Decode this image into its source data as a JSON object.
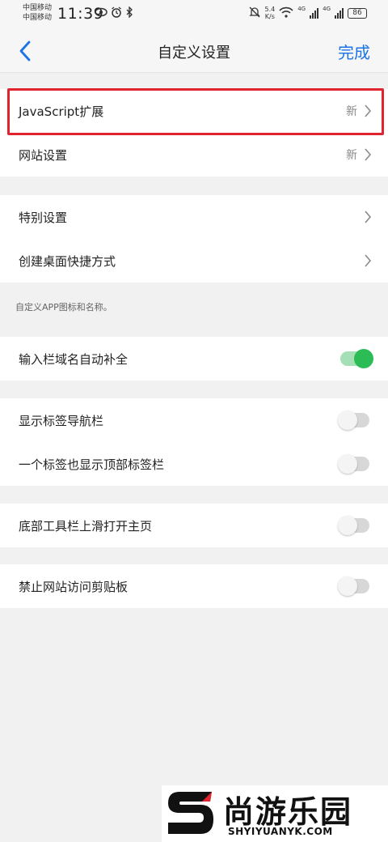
{
  "status_bar": {
    "carrier_1": "中国移动",
    "carrier_2": "中国移动",
    "time": "11:39",
    "net_speed_value": "5.4",
    "net_speed_unit": "K/s",
    "net_type_1": "4G",
    "net_type_2": "4G",
    "battery": "86",
    "icons": [
      "eye-icon",
      "alarm-icon",
      "bluetooth-icon",
      "mute-icon",
      "wifi-icon",
      "signal-icon",
      "battery-icon"
    ]
  },
  "nav": {
    "title": "自定义设置",
    "done_label": "完成",
    "accent_color": "#1a73e8"
  },
  "group1": [
    {
      "label": "JavaScript扩展",
      "badge": "新"
    },
    {
      "label": "网站设置",
      "badge": "新"
    }
  ],
  "group2": [
    {
      "label": "特别设置"
    },
    {
      "label": "创建桌面快捷方式"
    }
  ],
  "group2_hint": "自定义APP图标和名称。",
  "toggles": [
    {
      "label": "输入栏域名自动补全",
      "on": true
    },
    {
      "label": "显示标签导航栏",
      "on": false
    },
    {
      "label": "一个标签也显示顶部标签栏",
      "on": false
    },
    {
      "label": "底部工具栏上滑打开主页",
      "on": false
    },
    {
      "label": "禁止网站访问剪贴板",
      "on": false
    }
  ],
  "colors": {
    "highlight_border": "#e0232e",
    "toggle_on": "#2bbc55",
    "toggle_off": "#d7d7d7"
  },
  "watermark": {
    "cn_text": "尚游乐园",
    "en_text": "SHYIYUANYK.COM"
  }
}
